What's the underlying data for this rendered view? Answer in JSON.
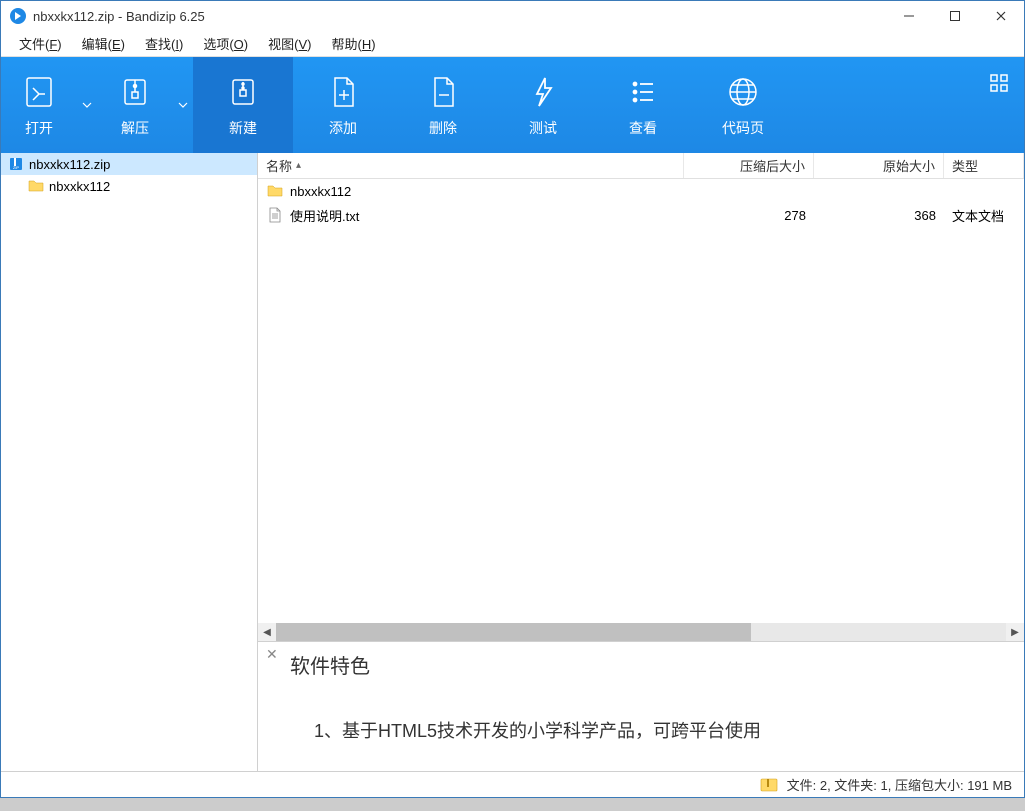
{
  "titlebar": {
    "title": "nbxxkx112.zip - Bandizip 6.25"
  },
  "menubar": {
    "items": [
      {
        "label": "文件(F)",
        "key": "F"
      },
      {
        "label": "编辑(E)",
        "key": "E"
      },
      {
        "label": "查找(I)",
        "key": "I"
      },
      {
        "label": "选项(O)",
        "key": "O"
      },
      {
        "label": "视图(V)",
        "key": "V"
      },
      {
        "label": "帮助(H)",
        "key": "H"
      }
    ]
  },
  "ribbon": {
    "open": "打开",
    "extract": "解压",
    "new": "新建",
    "add": "添加",
    "delete": "删除",
    "test": "测试",
    "view": "查看",
    "codepage": "代码页"
  },
  "sidebar": {
    "root": "nbxxkx112.zip",
    "child": "nbxxkx112"
  },
  "columns": {
    "name": "名称",
    "compressed_size": "压缩后大小",
    "original_size": "原始大小",
    "type": "类型"
  },
  "files": [
    {
      "name": "nbxxkx112",
      "icon": "folder",
      "compressed": "",
      "original": "",
      "type": ""
    },
    {
      "name": "使用说明.txt",
      "icon": "text",
      "compressed": "278",
      "original": "368",
      "type": "文本文档"
    }
  ],
  "description": {
    "title": "软件特色",
    "line1": "1、基于HTML5技术开发的小学科学产品，可跨平台使用"
  },
  "status": {
    "text": "文件: 2, 文件夹: 1, 压缩包大小: 191 MB"
  }
}
